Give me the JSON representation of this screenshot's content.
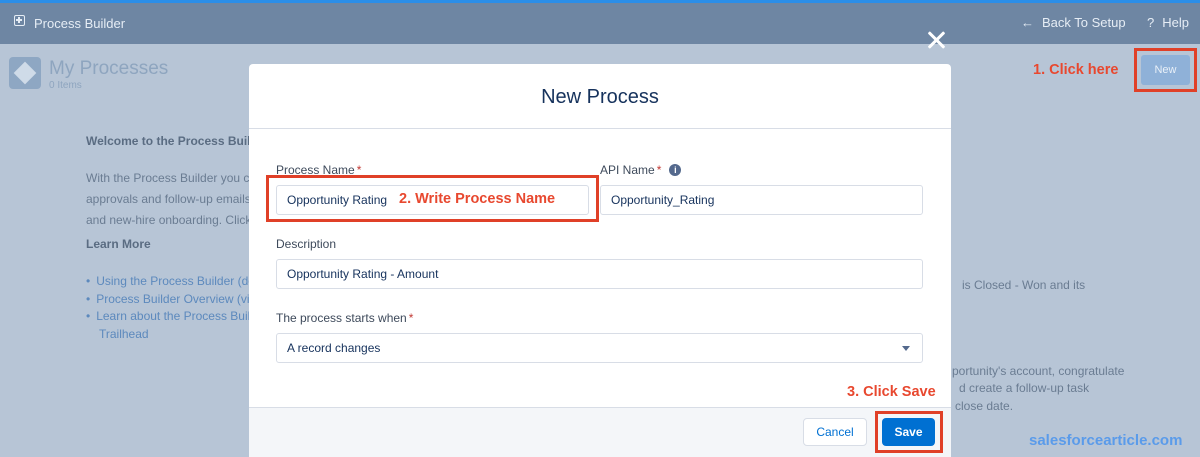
{
  "app": {
    "title": "Process Builder",
    "back_link": "Back To Setup",
    "help_link": "Help",
    "back_icon": "arrow-left-icon",
    "help_icon": "question-icon"
  },
  "page": {
    "title": "My Processes",
    "item_count": "0 Items",
    "new_button": "New",
    "welcome_heading": "Welcome to the Process Buil",
    "intro_lines": [
      "With the Process Builder you ca",
      "approvals and follow-up emails,",
      "and new-hire onboarding. Click"
    ],
    "learn_more_heading": "Learn More",
    "links": [
      "Using the Process Builder (do",
      "Process Builder Overview (vi",
      "Learn about the Process Buil",
      "Trailhead"
    ],
    "right_lines": [
      "is Closed - Won and its",
      "portunity's account, congratulate",
      "d create a follow-up task",
      "close date."
    ]
  },
  "modal": {
    "title": "New Process",
    "process_name_label": "Process Name",
    "process_name_value": "Opportunity Rating",
    "api_name_label": "API Name",
    "api_name_value": "Opportunity_Rating",
    "description_label": "Description",
    "description_value": "Opportunity Rating - Amount",
    "starts_when_label": "The process starts when",
    "starts_when_value": "A record changes",
    "required_mark": "*",
    "info_glyph": "i",
    "cancel_button": "Cancel",
    "save_button": "Save"
  },
  "annotations": {
    "step1": "1. Click here",
    "step2": "2. Write Process Name",
    "step3": "3. Click Save",
    "watermark": "salesforcearticle.com",
    "accent_color": "#e04028"
  },
  "colors": {
    "topbar": "#6e86a3",
    "primary_button": "#0070d2",
    "overlay_bg": "#b7c5d6"
  }
}
